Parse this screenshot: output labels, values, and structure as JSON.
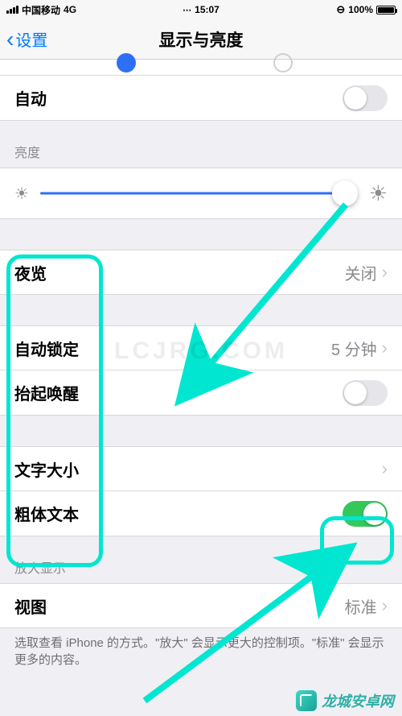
{
  "status": {
    "carrier": "中国移动",
    "network": "4G",
    "time": "15:07",
    "battery_pct": "100%",
    "orientation_lock_icon": "🔒"
  },
  "nav": {
    "back_label": "设置",
    "title": "显示与亮度"
  },
  "rows": {
    "auto": "自动",
    "auto_on": false,
    "brightness_header": "亮度",
    "brightness_value_pct": 96,
    "night_shift_label": "夜览",
    "night_shift_value": "关闭",
    "auto_lock_label": "自动锁定",
    "auto_lock_value": "5 分钟",
    "raise_to_wake_label": "抬起唤醒",
    "raise_to_wake_on": false,
    "text_size_label": "文字大小",
    "bold_text_label": "粗体文本",
    "bold_text_on": true,
    "zoom_header": "放大显示",
    "view_label": "视图",
    "view_value": "标准",
    "footer": "选取查看 iPhone 的方式。\"放大\" 会显示更大的控制项。\"标准\" 会显示更多的内容。"
  },
  "annotations": {
    "box_labels": {
      "left": "labels-highlight",
      "toggle": "bold-toggle-highlight"
    },
    "watermark_center": "LCJRG.COM",
    "watermark_br": "龙城安卓网"
  },
  "colors": {
    "accent": "#007aff",
    "slider": "#2e70f5",
    "switch_on": "#34c759",
    "annot": "#00e6d0"
  }
}
